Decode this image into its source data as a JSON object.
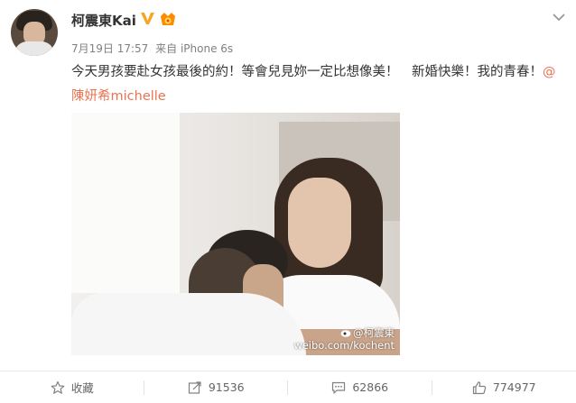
{
  "post": {
    "author": "柯震東Kai",
    "timestamp": "7月19日 17:57",
    "source": "来自 iPhone 6s",
    "text_part1": "今天男孩要赴女孩最後的約！等會兒見妳一定比想像美！　新婚快樂！我的青春！",
    "mention": "@陳妍希michelle",
    "image_watermark_line1": "@柯震東",
    "image_watermark_line2": "weibo.com/kochent",
    "badges": [
      "verified-v-icon",
      "vip-badge-icon"
    ],
    "accent_color": "#eb7350",
    "verified_color": "#f6a623"
  },
  "actions": [
    {
      "label": "收藏",
      "icon": "star-icon"
    },
    {
      "label": "91536",
      "icon": "repost-icon"
    },
    {
      "label": "62866",
      "icon": "comment-icon"
    },
    {
      "label": "774977",
      "icon": "thumbs-up-icon"
    }
  ]
}
